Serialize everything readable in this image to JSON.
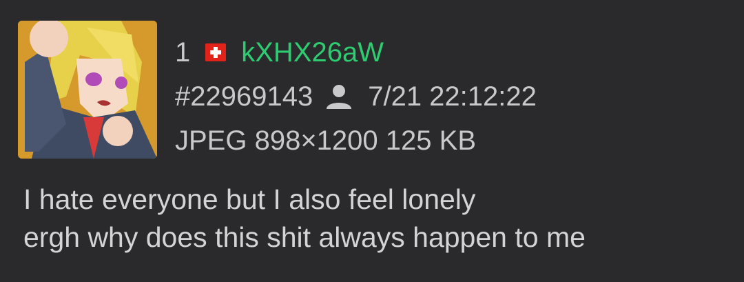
{
  "post": {
    "number": "1",
    "country_flag": "switzerland-flag",
    "poster_id": "kXHX26aW",
    "post_id": "#22969143",
    "timestamp": "7/21 22:12:22",
    "file_info": "JPEG 898×1200 125 KB",
    "thumbnail": "anime-character-thumbnail",
    "message_lines": [
      "I hate everyone but I also feel lonely",
      "ergh why does this shit always happen to me"
    ]
  },
  "colors": {
    "background": "#2a2a2c",
    "poster_id": "#2ecc71",
    "text": "#c9c9cc",
    "flag_red": "#e2231a"
  }
}
